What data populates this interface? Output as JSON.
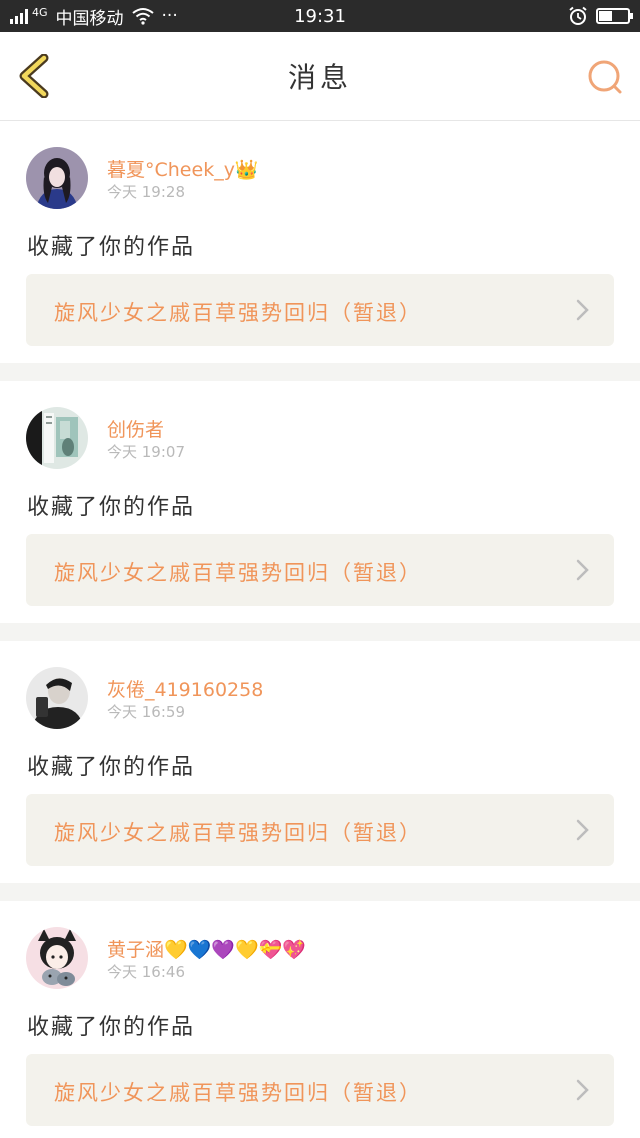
{
  "status_bar": {
    "carrier": "中国移动",
    "network": "4G",
    "more": "···",
    "time": "19:31",
    "battery_level": 0.45
  },
  "header": {
    "title": "消息",
    "back_icon": "chevron-left-icon",
    "search_icon": "search-icon",
    "accent": "#f0955a"
  },
  "messages": [
    {
      "username": "暮夏°Cheek_y👑",
      "time": "今天 19:28",
      "action": "收藏了你的作品",
      "work_title": "旋风少女之戚百草强势回归（暂退）"
    },
    {
      "username": "创伤者",
      "time": "今天 19:07",
      "action": "收藏了你的作品",
      "work_title": "旋风少女之戚百草强势回归（暂退）"
    },
    {
      "username": "灰倦_419160258",
      "time": "今天 16:59",
      "action": "收藏了你的作品",
      "work_title": "旋风少女之戚百草强势回归（暂退）"
    },
    {
      "username": "黄子涵💛💙💜💛💝💖",
      "time": "今天 16:46",
      "action": "收藏了你的作品",
      "work_title": "旋风少女之戚百草强势回归（暂退）"
    }
  ]
}
